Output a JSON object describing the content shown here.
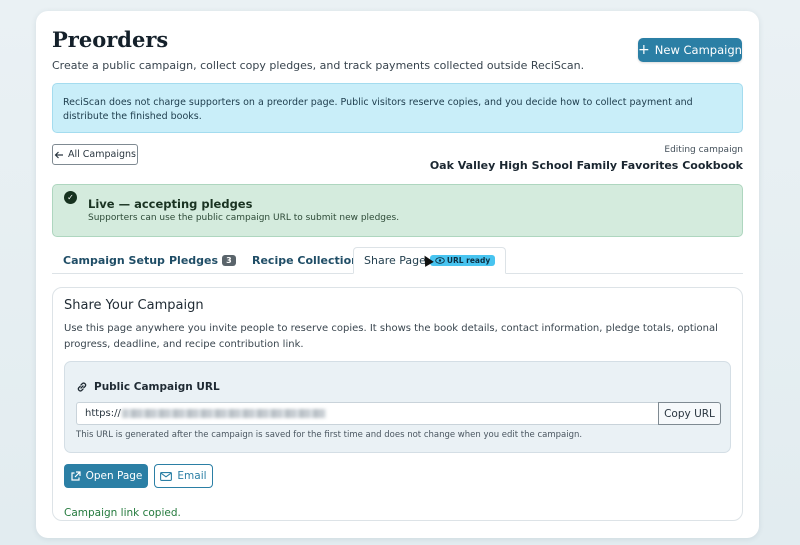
{
  "header": {
    "title": "Preorders",
    "subtitle": "Create a public campaign, collect copy pledges, and track payments collected outside ReciScan.",
    "new_campaign_label": "New Campaign"
  },
  "info_banner": {
    "text": "ReciScan does not charge supporters on a preorder page. Public visitors reserve copies, and you decide how to collect payment and distribute the finished books."
  },
  "nav": {
    "back_label": "All Campaigns",
    "editing_label": "Editing campaign",
    "campaign_name": "Oak Valley High School Family Favorites Cookbook"
  },
  "status": {
    "title": "Live — accepting pledges",
    "description": "Supporters can use the public campaign URL to submit new pledges."
  },
  "tabs": [
    {
      "label": "Campaign Setup"
    },
    {
      "label": "Pledges",
      "badge": "3"
    },
    {
      "label": "Recipe Collection"
    },
    {
      "label": "Share Page",
      "badge": "URL ready",
      "active": true
    }
  ],
  "share": {
    "title": "Share Your Campaign",
    "description": "Use this page anywhere you invite people to reserve copies. It shows the book details, contact information, pledge totals, optional progress, deadline, and recipe contribution link.",
    "url_label": "Public Campaign URL",
    "url_prefix": "https://",
    "copy_label": "Copy URL",
    "url_help": "This URL is generated after the campaign is saved for the first time and does not change when you edit the campaign.",
    "open_label": "Open Page",
    "email_label": "Email",
    "copied_message": "Campaign link copied."
  },
  "colors": {
    "primary": "#2b7fa5",
    "info_bg": "#c9eef9",
    "success_bg": "#d4ebdd",
    "success_text": "#247a3d"
  }
}
